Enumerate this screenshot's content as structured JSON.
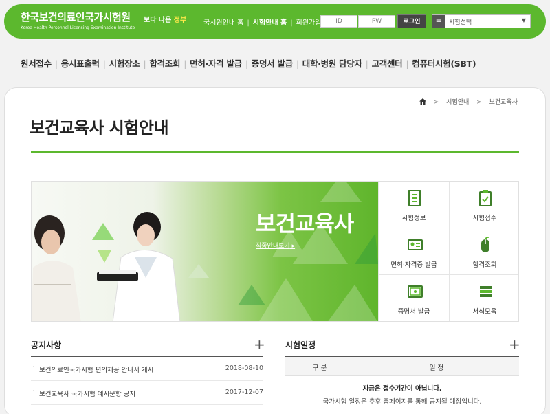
{
  "header": {
    "logo_kr": "한국보건의료인국가시험원",
    "logo_en": "Korea Health Personnel Licensing Examination Institute",
    "slogan": {
      "prefix": "보다 나은",
      "highlight": "정부"
    },
    "links": [
      "국시원안내 홈",
      "시험안내 홈",
      "회원가입"
    ],
    "login": {
      "id_placeholder": "ID",
      "pw_placeholder": "PW",
      "button": "로그인"
    },
    "exam_select": "시험선택"
  },
  "gnb": [
    "원서접수",
    "응시표출력",
    "시험장소",
    "합격조회",
    "면허·자격 발급",
    "증명서 발급",
    "대학·병원 담당자",
    "고객센터",
    "컴퓨터시험(SBT)"
  ],
  "breadcrumb": [
    "시험안내",
    "보건교육사"
  ],
  "page_title": "보건교육사 시험안내",
  "banner": {
    "title": "보건교육사",
    "link": "직종안내보기",
    "quick_links": [
      {
        "label": "시험정보",
        "icon": "document-list-icon"
      },
      {
        "label": "시험접수",
        "icon": "clipboard-check-icon"
      },
      {
        "label": "면허·자격증 발급",
        "icon": "id-card-icon"
      },
      {
        "label": "합격조회",
        "icon": "mouse-icon"
      },
      {
        "label": "증명서 발급",
        "icon": "certificate-icon"
      },
      {
        "label": "서식모음",
        "icon": "stacked-forms-icon"
      }
    ]
  },
  "notice": {
    "title": "공지사항",
    "more": "+",
    "rows": [
      {
        "title": "보건의료인국가시험 편의제공 안내서 게시",
        "date": "2018-08-10"
      },
      {
        "title": "보건교육사 국가시험 예시문항 공지",
        "date": "2017-12-07"
      }
    ]
  },
  "schedule": {
    "title": "시험일정",
    "more": "+",
    "columns": [
      "구 분",
      "일 정"
    ],
    "message_line1": "지금은 접수기간이 아닙니다.",
    "message_line2": "국가시험 일정은 추후 홈페이지를 통해 공지될 예정입니다."
  },
  "colors": {
    "brand_green": "#5cb82e",
    "dark": "#444444"
  }
}
